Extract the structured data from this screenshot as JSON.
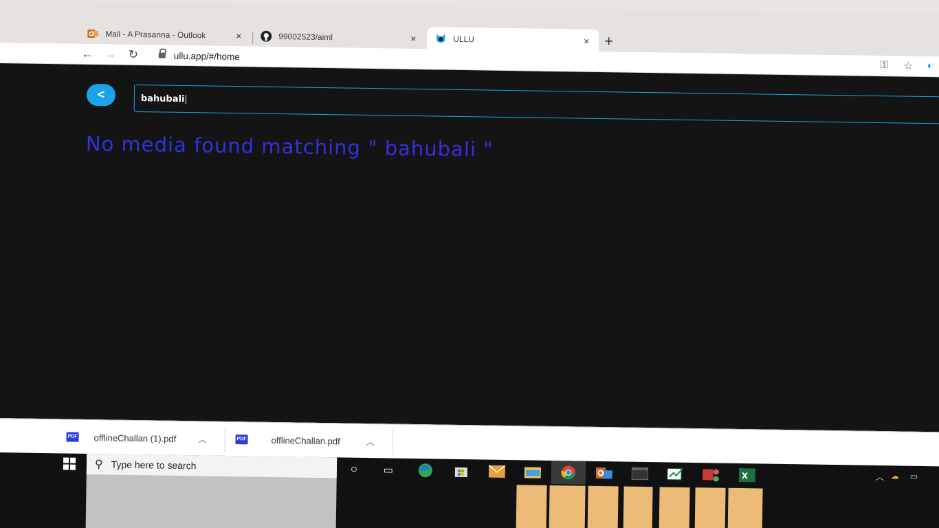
{
  "browser": {
    "tabs": [
      {
        "title": "Mail - A Prasanna - Outlook",
        "icon": "outlook-icon"
      },
      {
        "title": "99002523/aiml",
        "icon": "github-icon"
      },
      {
        "title": "ULLU",
        "icon": "ullu-icon",
        "active": true
      }
    ],
    "new_tab": "+",
    "close_glyph": "×",
    "url": "ullu.app/#/home"
  },
  "page": {
    "back_label": "<",
    "search_value": "bahubali",
    "no_media_message": "No media found matching \" bahubali \"",
    "accent_color": "#1aa3e8",
    "message_color": "#3430e0"
  },
  "downloads": [
    {
      "filename": "offlineChallan (1).pdf",
      "icon_label": "PDF"
    },
    {
      "filename": "offlineChallan.pdf",
      "icon_label": "PDF"
    }
  ],
  "taskbar": {
    "search_placeholder": "Type here to search",
    "apps": [
      "cortana-icon",
      "task-view-icon",
      "edge-icon",
      "store-icon",
      "mail-icon",
      "file-explorer-icon",
      "chrome-icon",
      "outlook-icon",
      "terminal-icon",
      "whiteboard-icon",
      "teams-icon",
      "excel-icon"
    ]
  }
}
